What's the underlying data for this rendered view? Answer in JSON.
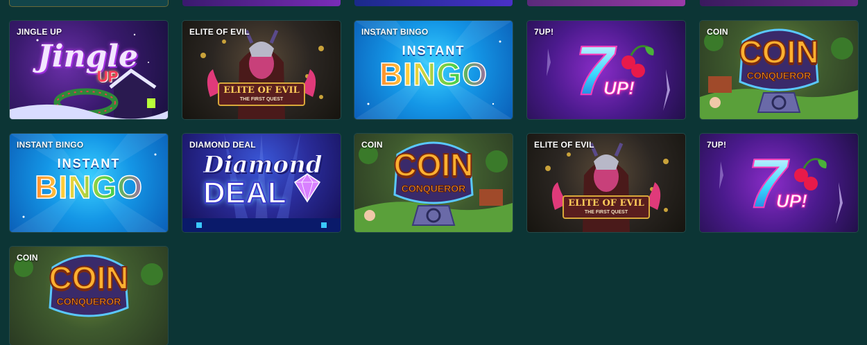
{
  "games": [
    {
      "title": "JINGLE UP",
      "logo_line1": "Jingle",
      "logo_line2": "UP"
    },
    {
      "title": "ELITE OF EVIL",
      "logo_line1": "ELITE OF EVIL",
      "logo_line2": "THE FIRST QUEST"
    },
    {
      "title": "INSTANT BINGO",
      "logo_line1": "INSTANT",
      "logo_line2": "BINGO"
    },
    {
      "title": "7UP!",
      "logo_line1": "7",
      "logo_line2": "UP!"
    },
    {
      "title": "COIN",
      "logo_line1": "COIN",
      "logo_line2": "CONQUEROR"
    },
    {
      "title": "INSTANT BINGO",
      "logo_line1": "INSTANT",
      "logo_line2": "BINGO"
    },
    {
      "title": "DIAMOND DEAL",
      "logo_line1": "Diamond",
      "logo_line2": "DEAL"
    },
    {
      "title": "COIN",
      "logo_line1": "COIN",
      "logo_line2": "CONQUEROR"
    },
    {
      "title": "ELITE OF EVIL",
      "logo_line1": "ELITE OF EVIL",
      "logo_line2": "THE FIRST QUEST"
    },
    {
      "title": "7UP!",
      "logo_line1": "7",
      "logo_line2": "UP!"
    },
    {
      "title": "COIN",
      "logo_line1": "COIN",
      "logo_line2": "CONQUEROR"
    }
  ],
  "colors": {
    "page_background": "#0c3535",
    "tile_title": "#ffffff"
  }
}
